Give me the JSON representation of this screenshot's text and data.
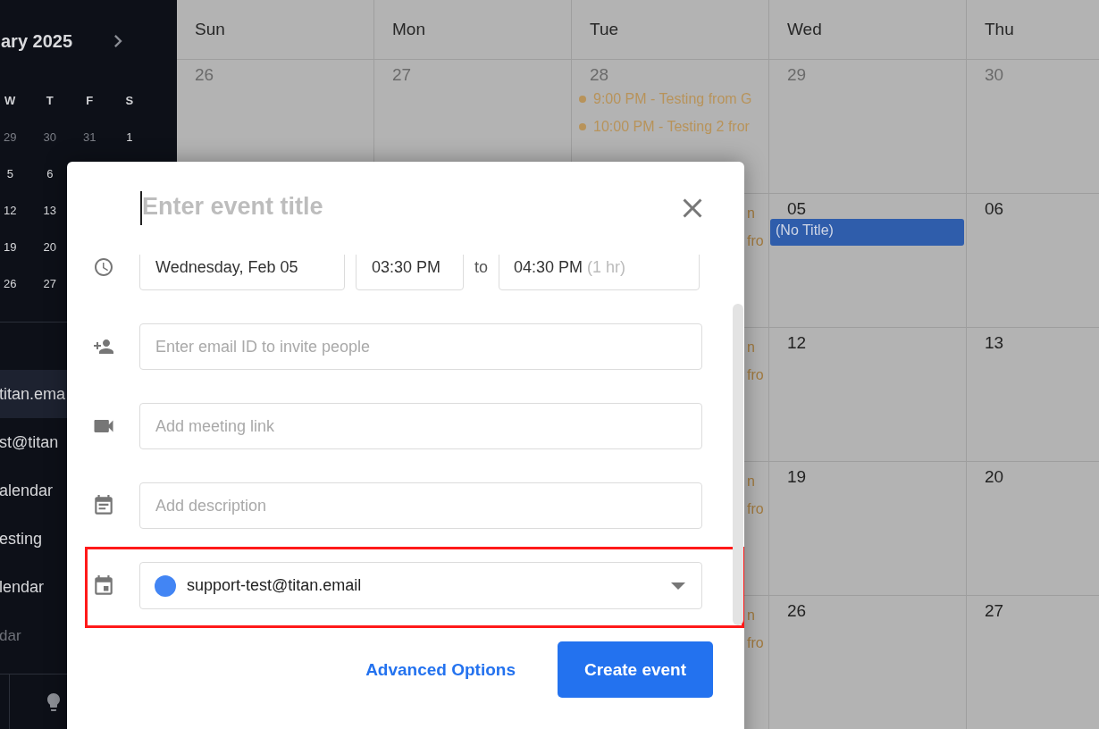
{
  "sidebar": {
    "month_title": "ary 2025",
    "weekdays": [
      "W",
      "T",
      "F",
      "S"
    ],
    "mini_weeks": [
      [
        {
          "day": "29",
          "other_month": true
        },
        {
          "day": "30",
          "other_month": true
        },
        {
          "day": "31",
          "other_month": true
        },
        {
          "day": "1",
          "other_month": false
        }
      ],
      [
        {
          "day": "5",
          "other_month": false
        },
        {
          "day": "6",
          "other_month": false
        }
      ],
      [
        {
          "day": "12",
          "other_month": false
        },
        {
          "day": "13",
          "other_month": false
        }
      ],
      [
        {
          "day": "19",
          "other_month": false
        },
        {
          "day": "20",
          "other_month": false
        }
      ],
      [
        {
          "day": "26",
          "other_month": false
        },
        {
          "day": "27",
          "other_month": false
        }
      ]
    ],
    "calendars": [
      {
        "label": "titan.ema",
        "selected": true
      },
      {
        "label": "st@titan",
        "selected": false
      },
      {
        "label": "alendar",
        "selected": false
      },
      {
        "label": "esting",
        "selected": false
      },
      {
        "label": "lendar",
        "selected": false
      }
    ],
    "section_label": "dar"
  },
  "calendar": {
    "weekdays": [
      "Sun",
      "Mon",
      "Tue",
      "Wed",
      "Thu"
    ],
    "weeks": [
      [
        {
          "day": "26",
          "other_month": true
        },
        {
          "day": "27",
          "other_month": true
        },
        {
          "day": "28",
          "other_month": true,
          "events": [
            {
              "kind": "dot",
              "text": "9:00 PM - Testing from G"
            },
            {
              "kind": "dot",
              "text": "10:00 PM - Testing 2 fror"
            }
          ]
        },
        {
          "day": "29",
          "other_month": true
        },
        {
          "day": "30",
          "other_month": true
        }
      ],
      [
        {
          "events": [
            {
              "kind": "fragment",
              "text": "n"
            },
            {
              "kind": "fragment",
              "text": "fro"
            }
          ]
        },
        {
          "day": "05",
          "other_month": false,
          "events": [
            {
              "kind": "bar",
              "text": "(No Title)"
            }
          ]
        },
        {
          "day": "06",
          "other_month": false
        }
      ],
      [
        {
          "events": [
            {
              "kind": "fragment",
              "text": "n"
            },
            {
              "kind": "fragment",
              "text": "fro"
            }
          ]
        },
        {
          "day": "12",
          "other_month": false
        },
        {
          "day": "13",
          "other_month": false
        }
      ],
      [
        {
          "events": [
            {
              "kind": "fragment",
              "text": "n"
            },
            {
              "kind": "fragment",
              "text": "fro"
            }
          ]
        },
        {
          "day": "19",
          "other_month": false
        },
        {
          "day": "20",
          "other_month": false
        }
      ],
      [
        {
          "events": [
            {
              "kind": "fragment",
              "text": "n"
            },
            {
              "kind": "fragment",
              "text": "fro"
            }
          ]
        },
        {
          "day": "26",
          "other_month": false
        },
        {
          "day": "27",
          "other_month": false
        }
      ]
    ]
  },
  "modal": {
    "title": {
      "placeholder": "Enter event title"
    },
    "date": "Wednesday, Feb 05",
    "start_time": "03:30 PM",
    "to_label": "to",
    "end_time": "04:30 PM",
    "duration": "(1 hr)",
    "invite": {
      "placeholder": "Enter email ID to invite people"
    },
    "meeting_link": {
      "placeholder": "Add meeting link"
    },
    "description": {
      "placeholder": "Add description"
    },
    "calendar_select": {
      "value": "support-test@titan.email",
      "highlighted": true
    },
    "advanced_options": "Advanced Options",
    "create_button": "Create event"
  }
}
